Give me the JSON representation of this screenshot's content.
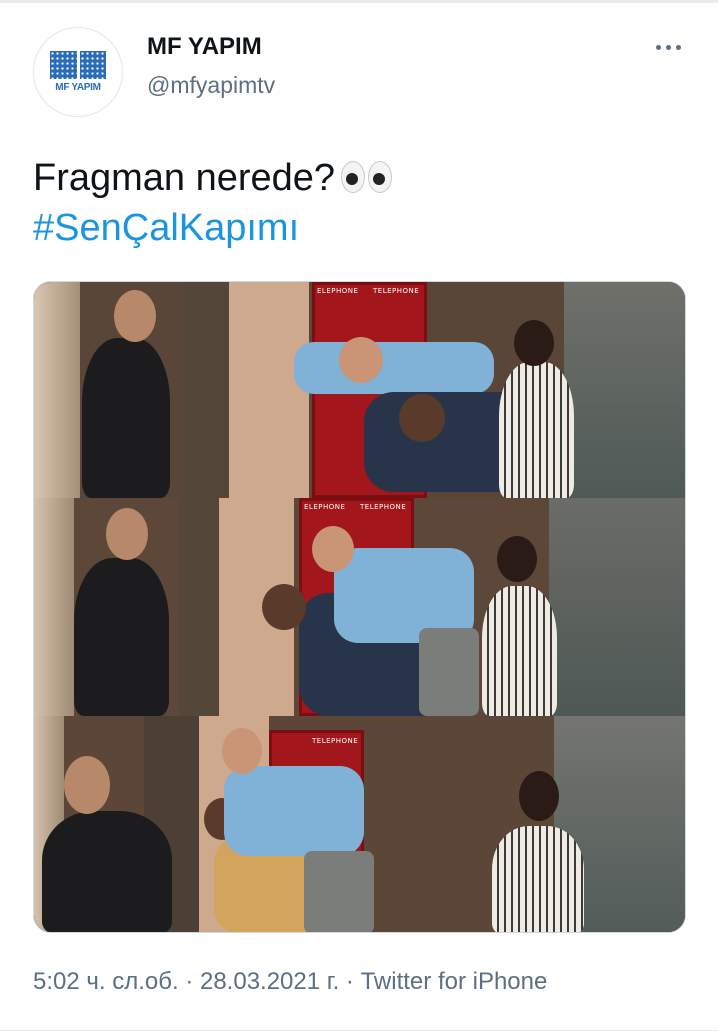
{
  "author": {
    "name": "MF YAPIM",
    "handle": "@mfyapimtv",
    "avatar_logo_text": "MF YAPIM"
  },
  "tweet": {
    "text": "Fragman nerede?",
    "emoji": "eyes",
    "hashtag": "#SenÇalKapımı"
  },
  "media": {
    "booth_sign_left": "ELEPHONE",
    "booth_sign_right": "TELEPHONE"
  },
  "meta": {
    "time": "5:02 ч. сл.об.",
    "separator": " · ",
    "date": "28.03.2021 г.",
    "source": "Twitter for iPhone"
  },
  "icons": {
    "more": "more-horizontal-icon"
  },
  "colors": {
    "link": "#1b95e0",
    "secondary_text": "#5b7083",
    "logo_blue": "#2a6cb5"
  }
}
